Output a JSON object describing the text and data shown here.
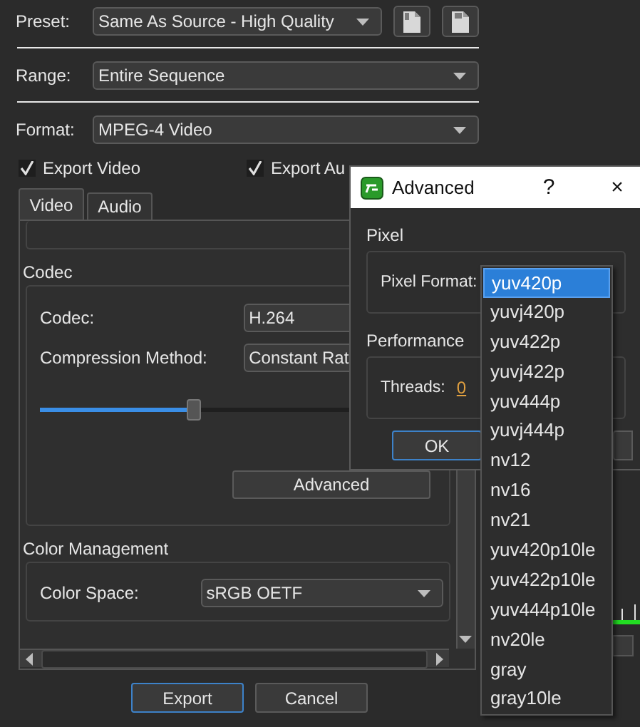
{
  "preset": {
    "label": "Preset:",
    "value": "Same As Source - High Quality"
  },
  "range": {
    "label": "Range:",
    "value": "Entire Sequence"
  },
  "format": {
    "label": "Format:",
    "value": "MPEG-4 Video"
  },
  "checkboxes": [
    {
      "label": "Export Video",
      "checked": true
    },
    {
      "label": "Export Au",
      "checked": true
    }
  ],
  "tabs": [
    {
      "label": "Video",
      "selected": true
    },
    {
      "label": "Audio",
      "selected": false
    }
  ],
  "groups": [
    {
      "title": "Codec",
      "rows": [
        {
          "kind": "combo",
          "label": "Codec:",
          "value": "H.264"
        },
        {
          "kind": "combo",
          "label": "Compression Method:",
          "value": "Constant Rat"
        },
        {
          "kind": "slider",
          "level": 0.39
        },
        {
          "kind": "button",
          "label": "Advanced"
        }
      ]
    },
    {
      "title": "Color Management",
      "rows": [
        {
          "kind": "combo",
          "label": "Color Space:",
          "value": "sRGB OETF",
          "arrow": true
        }
      ]
    }
  ],
  "buttons": [
    {
      "label": "Export",
      "focused": true
    },
    {
      "label": "Cancel",
      "focused": false
    }
  ],
  "advanced_dialog": {
    "title": "Advanced",
    "help": "?",
    "close": "×",
    "pixel": {
      "title": "Pixel",
      "label": "Pixel Format:"
    },
    "performance": {
      "title": "Performance",
      "label": "Threads:",
      "value": "0"
    },
    "ok": "OK"
  },
  "pixel_formats": [
    {
      "label": "yuv420p",
      "selected": true
    },
    {
      "label": "yuvj420p",
      "selected": false
    },
    {
      "label": "yuv422p",
      "selected": false
    },
    {
      "label": "yuvj422p",
      "selected": false
    },
    {
      "label": "yuv444p",
      "selected": false
    },
    {
      "label": "yuvj444p",
      "selected": false
    },
    {
      "label": "nv12",
      "selected": false
    },
    {
      "label": "nv16",
      "selected": false
    },
    {
      "label": "nv21",
      "selected": false
    },
    {
      "label": "yuv420p10le",
      "selected": false
    },
    {
      "label": "yuv422p10le",
      "selected": false
    },
    {
      "label": "yuv444p10le",
      "selected": false
    },
    {
      "label": "nv20le",
      "selected": false
    },
    {
      "label": "gray",
      "selected": false
    },
    {
      "label": "gray10le",
      "selected": false
    }
  ]
}
